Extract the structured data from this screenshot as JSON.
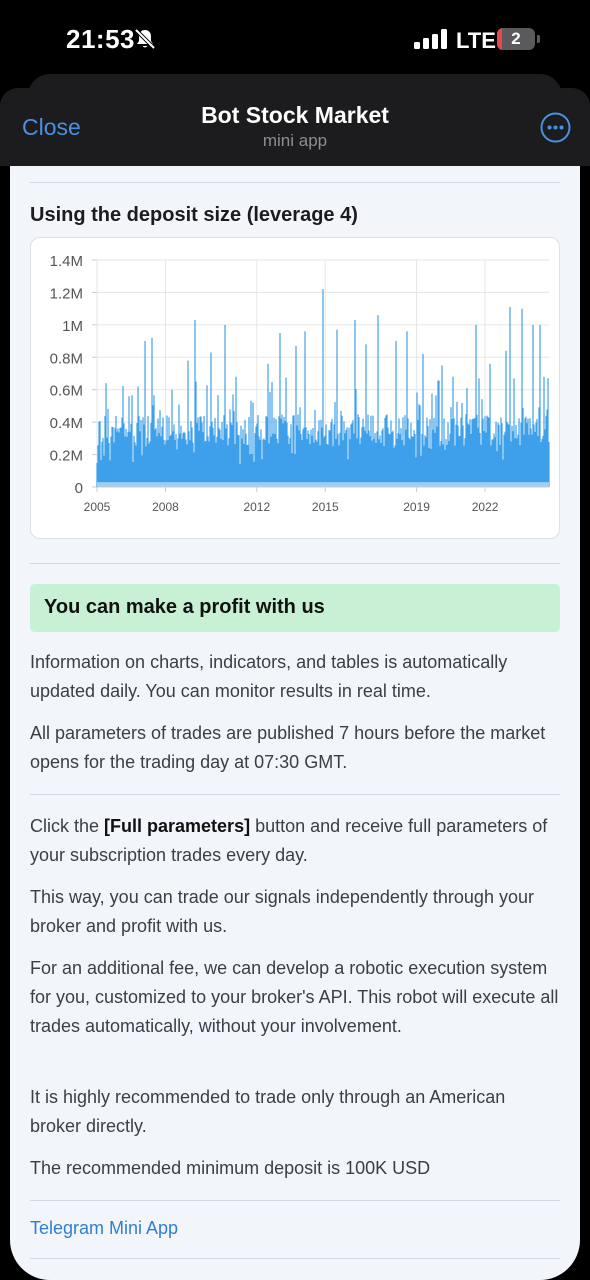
{
  "status_bar": {
    "time": "21:53",
    "network": "LTE",
    "battery_level": "2"
  },
  "header": {
    "close_label": "Close",
    "title": "Bot Stock Market",
    "subtitle": "mini app"
  },
  "chart_section": {
    "title": "Using the deposit size (leverage 4)"
  },
  "chart_data": {
    "type": "bar",
    "title": "",
    "xlabel": "",
    "ylabel": "",
    "x_range": [
      2005,
      2024.8
    ],
    "ylim": [
      0,
      1400000
    ],
    "y_ticks": [
      0,
      200000,
      400000,
      600000,
      800000,
      1000000,
      1200000,
      1400000
    ],
    "y_tick_labels": [
      "0",
      "0.2M",
      "0.4M",
      "0.6M",
      "0.8M",
      "1M",
      "1.2M",
      "1.4M"
    ],
    "x_ticks": [
      2005,
      2008,
      2012,
      2015,
      2019,
      2022
    ],
    "x_tick_labels": [
      "2005",
      "2008",
      "2012",
      "2015",
      "2019",
      "2022"
    ],
    "grid": true,
    "series": [
      {
        "color": "#3fa0ea",
        "note_values_approx": true,
        "baseline_range": [
          250000,
          450000
        ],
        "peaks": [
          {
            "x": 2005.4,
            "y": 640000
          },
          {
            "x": 2006.4,
            "y": 560000
          },
          {
            "x": 2006.8,
            "y": 620000
          },
          {
            "x": 2007.1,
            "y": 900000
          },
          {
            "x": 2007.4,
            "y": 920000
          },
          {
            "x": 2008.3,
            "y": 600000
          },
          {
            "x": 2009.0,
            "y": 780000
          },
          {
            "x": 2009.3,
            "y": 1030000
          },
          {
            "x": 2010.0,
            "y": 830000
          },
          {
            "x": 2010.6,
            "y": 1000000
          },
          {
            "x": 2011.1,
            "y": 680000
          },
          {
            "x": 2012.5,
            "y": 760000
          },
          {
            "x": 2013.0,
            "y": 950000
          },
          {
            "x": 2013.7,
            "y": 870000
          },
          {
            "x": 2014.1,
            "y": 960000
          },
          {
            "x": 2014.9,
            "y": 1220000
          },
          {
            "x": 2015.5,
            "y": 970000
          },
          {
            "x": 2016.3,
            "y": 1030000
          },
          {
            "x": 2016.8,
            "y": 880000
          },
          {
            "x": 2017.3,
            "y": 1060000
          },
          {
            "x": 2018.1,
            "y": 900000
          },
          {
            "x": 2018.6,
            "y": 960000
          },
          {
            "x": 2019.3,
            "y": 820000
          },
          {
            "x": 2020.1,
            "y": 750000
          },
          {
            "x": 2020.6,
            "y": 680000
          },
          {
            "x": 2021.2,
            "y": 610000
          },
          {
            "x": 2021.6,
            "y": 1000000
          },
          {
            "x": 2022.2,
            "y": 760000
          },
          {
            "x": 2022.9,
            "y": 840000
          },
          {
            "x": 2023.1,
            "y": 1110000
          },
          {
            "x": 2023.6,
            "y": 1100000
          },
          {
            "x": 2024.1,
            "y": 1000000
          },
          {
            "x": 2024.4,
            "y": 1000000
          },
          {
            "x": 2024.6,
            "y": 680000
          }
        ]
      }
    ]
  },
  "profit_banner": "You can make a profit with us",
  "paragraphs": {
    "p1": "Information on charts, indicators, and tables is automatically updated daily. You can monitor results in real time.",
    "p2": "All parameters of trades are published 7 hours before the market opens for the trading day at 07:30 GMT.",
    "p3_pre": "Click the ",
    "p3_bold": "[Full parameters]",
    "p3_post": " button and receive full parameters of your subscription trades every day.",
    "p4": "This way, you can trade our signals independently through your broker and profit with us.",
    "p5": "For an additional fee, we can develop a robotic execution system for you, customized to your broker's API. This robot will execute all trades automatically, without your involvement.",
    "p6": "It is highly recommended to trade only through an American broker directly.",
    "p7": "The recommended minimum deposit is 100K USD"
  },
  "footer": {
    "link_label": "Telegram Mini App"
  },
  "colors": {
    "accent": "#4a90e2",
    "bar": "#3fa0ea",
    "banner": "#c8f0d4",
    "header_bg": "#1c1c1e"
  },
  "icons": [
    "bell-slash-icon",
    "signal-bars-icon",
    "battery-icon",
    "more-icon"
  ]
}
